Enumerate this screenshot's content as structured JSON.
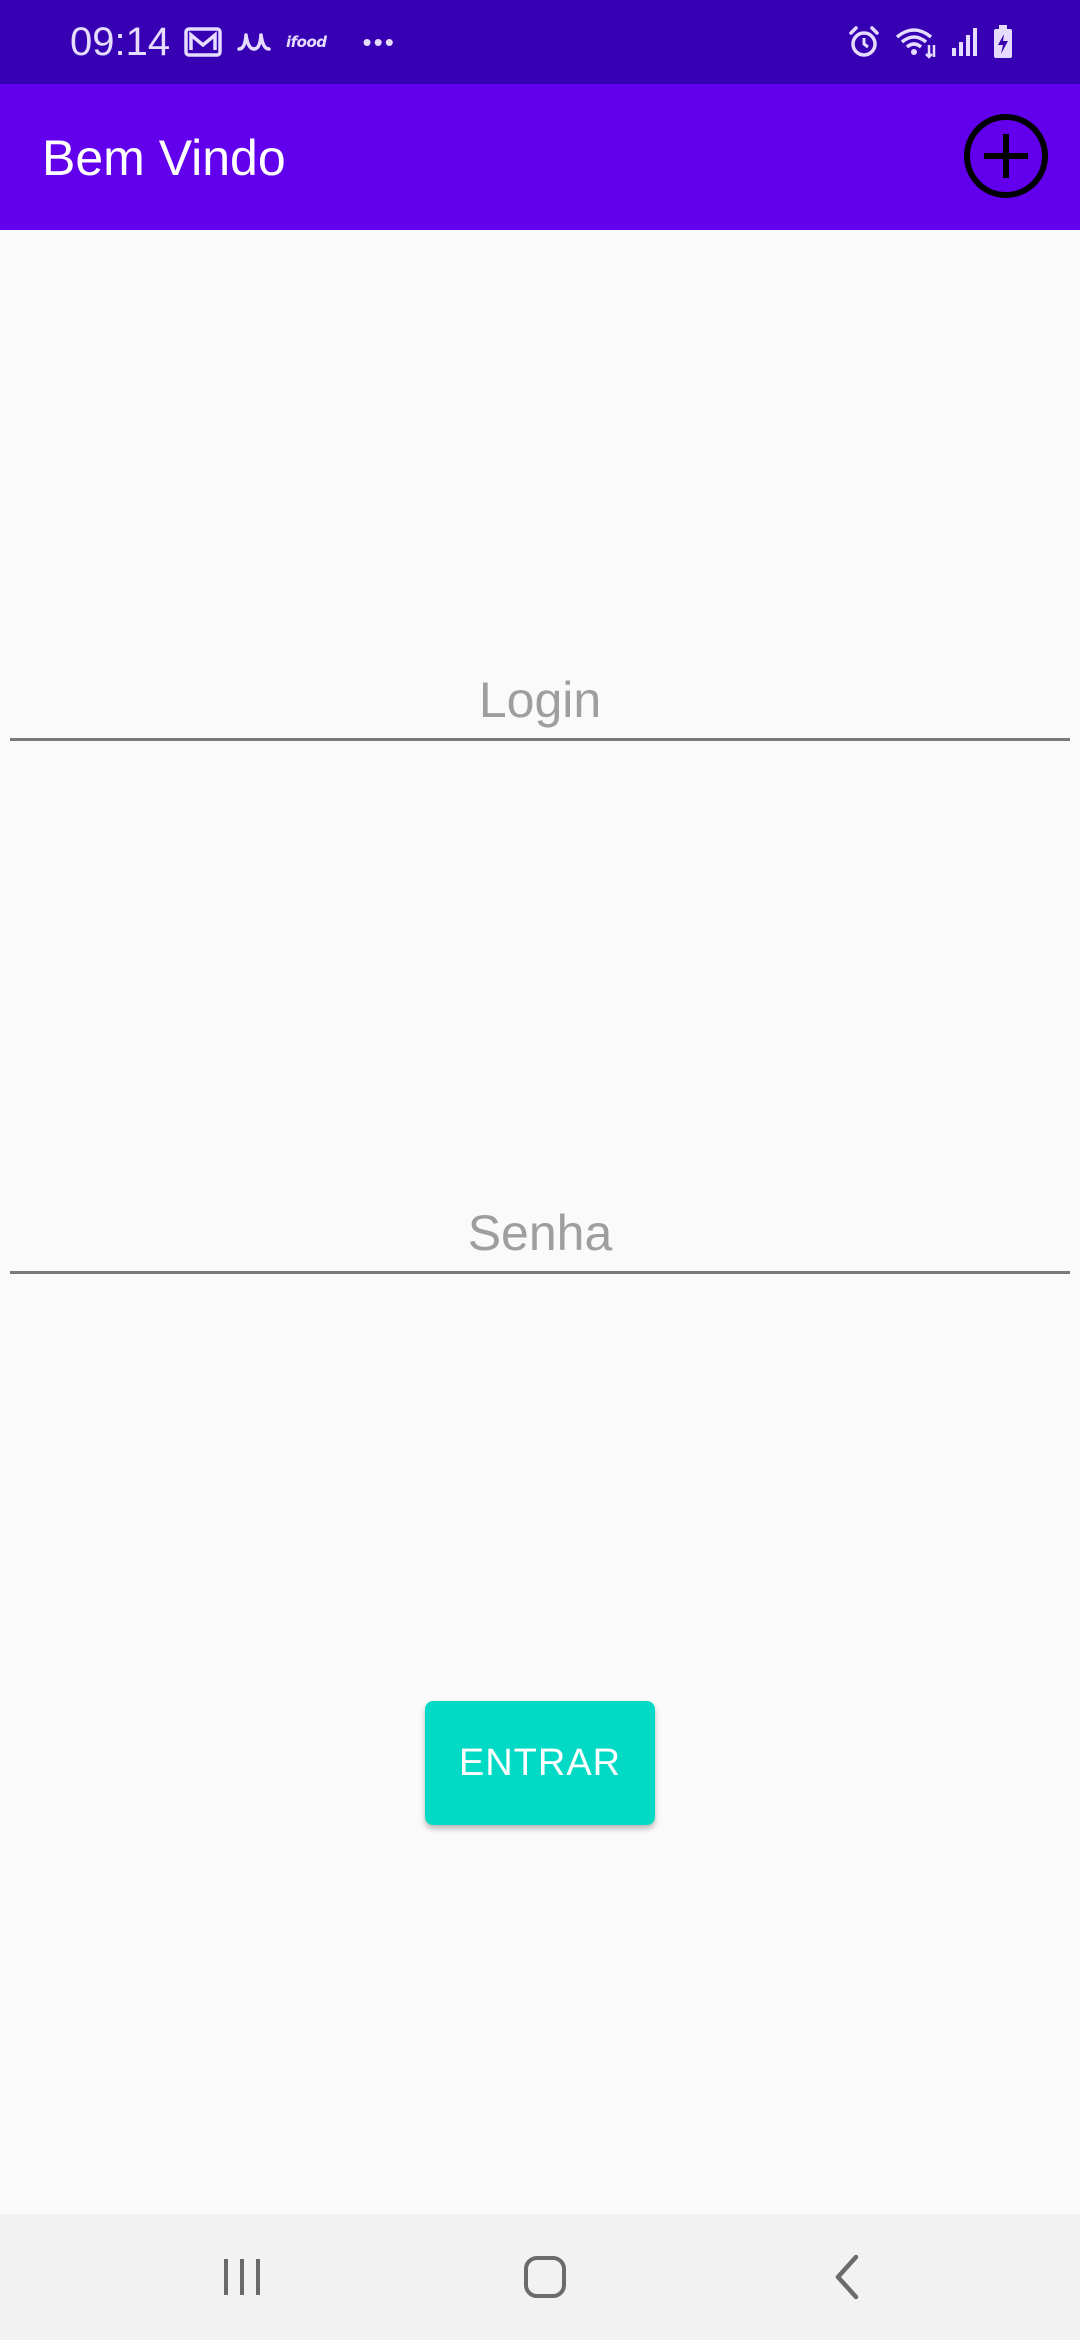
{
  "status_bar": {
    "time": "09:14",
    "ifood_label": "ifood",
    "more_label": "•••",
    "left_icons": [
      "gmail-icon",
      "app-notification-icon",
      "ifood-icon",
      "more-notifications-icon"
    ],
    "right_icons": [
      "alarm-icon",
      "wifi-icon",
      "signal-icon",
      "battery-charging-icon"
    ]
  },
  "app_bar": {
    "title": "Bem Vindo",
    "action_icon": "add-circle-icon",
    "background": "#6200ee",
    "status_background": "#3700b3"
  },
  "form": {
    "login_placeholder": "Login",
    "login_value": "",
    "password_placeholder": "Senha",
    "password_value": "",
    "submit_label": "ENTRAR",
    "submit_color": "#03dac5"
  },
  "nav_bar": {
    "buttons": [
      "recents-icon",
      "home-icon",
      "back-icon"
    ]
  }
}
